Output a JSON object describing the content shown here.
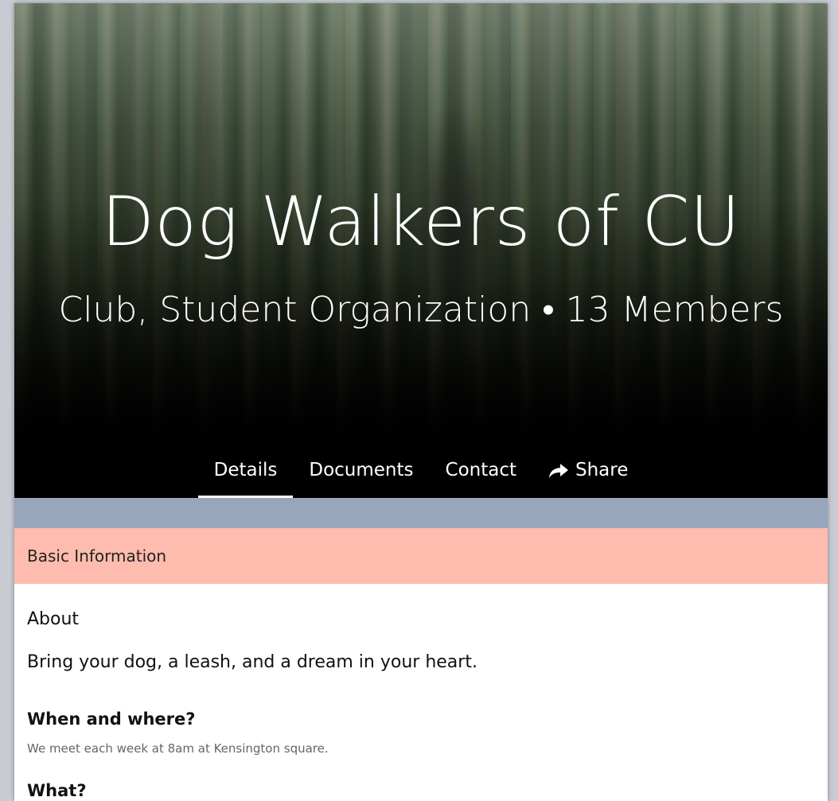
{
  "hero": {
    "title": "Dog Walkers of CU",
    "subtitle": "Club, Student Organization • 13 Members"
  },
  "tabs": [
    {
      "label": "Details",
      "active": true
    },
    {
      "label": "Documents",
      "active": false
    },
    {
      "label": "Contact",
      "active": false
    },
    {
      "label": "Share",
      "active": false,
      "icon": "share-arrow-icon"
    }
  ],
  "section": {
    "header": "Basic Information"
  },
  "about": {
    "label": "About",
    "text": "Bring your dog, a leash, and a dream in your heart."
  },
  "faq": [
    {
      "question": "When and where?",
      "answer": "We meet each week at 8am at Kensington square."
    },
    {
      "question": "What?",
      "answer": ""
    }
  ],
  "colors": {
    "steel_band": "#98a6bb",
    "section_header": "#fdbcae",
    "answer_text": "#666666"
  }
}
